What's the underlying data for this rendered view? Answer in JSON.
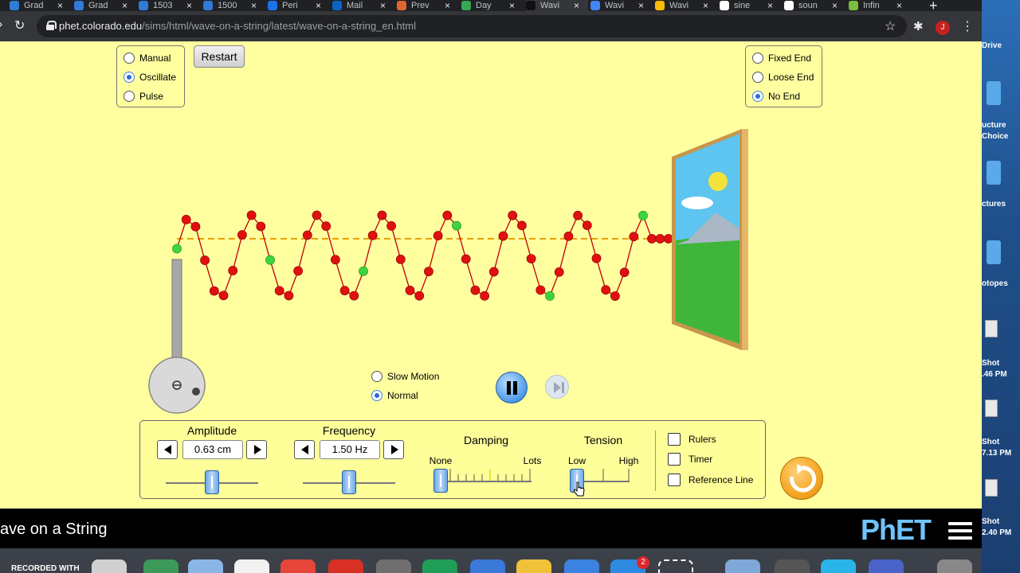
{
  "browser": {
    "tabs": [
      {
        "title": "Grad",
        "color": "#2f7bd8"
      },
      {
        "title": "Grad",
        "color": "#2f7bd8"
      },
      {
        "title": "1503",
        "color": "#2f7bd8"
      },
      {
        "title": "1500",
        "color": "#2f7bd8"
      },
      {
        "title": "Peri",
        "color": "#1a73e8"
      },
      {
        "title": "Mail",
        "color": "#0a66c2"
      },
      {
        "title": "Prev",
        "color": "#e0662f"
      },
      {
        "title": "Day",
        "color": "#34a853"
      },
      {
        "title": "Wavi",
        "color": "#111111"
      },
      {
        "title": "Wavi",
        "color": "#4285f4"
      },
      {
        "title": "Wavi",
        "color": "#fbbc04"
      },
      {
        "title": "sine",
        "color": "#ffffff"
      },
      {
        "title": "soun",
        "color": "#ffffff"
      },
      {
        "title": "Infin",
        "color": "#7cbf3c"
      }
    ],
    "url_host": "phet.colorado.edu",
    "url_path": "/sims/html/wave-on-a-string/latest/wave-on-a-string_en.html",
    "avatar_letter": "J"
  },
  "sim": {
    "mode_options": [
      "Manual",
      "Oscillate",
      "Pulse"
    ],
    "mode_selected": "Oscillate",
    "restart_label": "Restart",
    "end_options": [
      "Fixed End",
      "Loose End",
      "No End"
    ],
    "end_selected": "No End",
    "speed_options": [
      "Slow Motion",
      "Normal"
    ],
    "speed_selected": "Normal",
    "amplitude": {
      "label": "Amplitude",
      "value": "0.63 cm",
      "slider_fraction": 0.5
    },
    "frequency": {
      "label": "Frequency",
      "value": "1.50 Hz",
      "slider_fraction": 0.5
    },
    "damping": {
      "label": "Damping",
      "min_label": "None",
      "max_label": "Lots",
      "slider_fraction": 0.0
    },
    "tension": {
      "label": "Tension",
      "min_label": "Low",
      "max_label": "High",
      "slider_fraction": 0.0
    },
    "checkboxes": [
      "Rulers",
      "Timer",
      "Reference Line"
    ],
    "title": "ave on a String"
  },
  "desktop": {
    "labels": [
      "Drive",
      "ucture",
      "Choice",
      "ctures",
      "otopes",
      "Shot",
      ".46 PM",
      "Shot",
      "7.13 PM",
      "Shot",
      "2.40 PM"
    ]
  },
  "dock": {
    "recorded_label": "RECORDED WITH",
    "badge_count": "2"
  },
  "colors": {
    "sim_bg": "#ffffa0",
    "bead_red": "#e01010",
    "bead_green": "#3fd23f",
    "accent_blue": "#3f7fe6"
  }
}
